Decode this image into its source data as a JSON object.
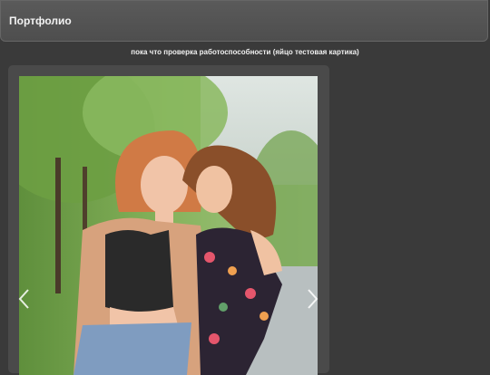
{
  "header": {
    "title": "Портфолио"
  },
  "main": {
    "subtitle": "пока что проверка работоспособности (яйцо тестовая картика)"
  },
  "carousel": {
    "prev_icon": "chevron-left-icon",
    "next_icon": "chevron-right-icon"
  },
  "colors": {
    "background": "#3a3a3a",
    "header": "#555555",
    "panel": "#4a4a4a",
    "text": "#f2f2f2"
  }
}
